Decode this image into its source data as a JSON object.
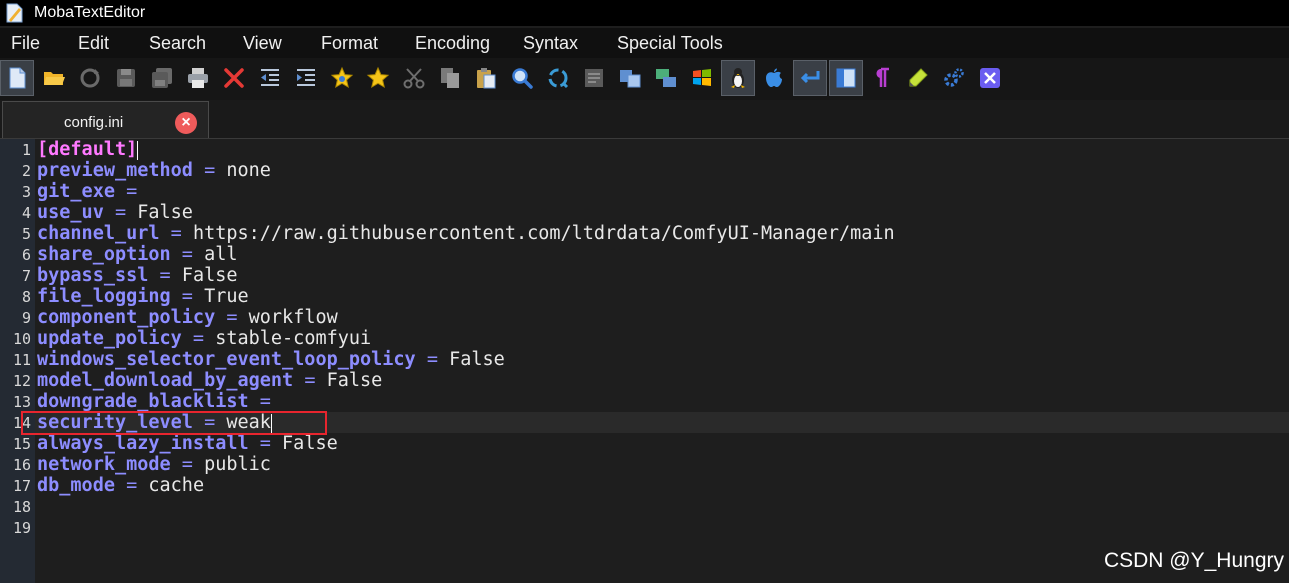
{
  "window": {
    "title": "MobaTextEditor"
  },
  "menu": [
    "File",
    "Edit",
    "Search",
    "View",
    "Format",
    "Encoding",
    "Syntax",
    "Special Tools"
  ],
  "toolbar_icons": [
    "new-file-icon",
    "open-folder-icon",
    "reload-icon",
    "save-icon",
    "save-all-icon",
    "print-icon",
    "close-file-icon",
    "unindent-icon",
    "indent-icon",
    "toggle-bookmark-icon",
    "next-bookmark-icon",
    "cut-icon",
    "copy-icon",
    "paste-icon",
    "find-icon",
    "find-replace-icon",
    "go-to-line-icon",
    "compare-icon",
    "convert-icon",
    "windows-eol-icon",
    "linux-eol-icon",
    "mac-eol-icon",
    "word-wrap-icon",
    "side-panel-icon",
    "show-symbols-icon",
    "highlight-icon",
    "settings-icon",
    "exit-icon"
  ],
  "tab": {
    "label": "config.ini",
    "close_symbol": "×"
  },
  "editor": {
    "line_numbers": [
      "1",
      "2",
      "3",
      "4",
      "5",
      "6",
      "7",
      "8",
      "9",
      "10",
      "11",
      "12",
      "13",
      "14",
      "15",
      "16",
      "17",
      "18",
      "19"
    ],
    "lines": [
      {
        "section": "[default]"
      },
      {
        "key": "preview_method",
        "eq": " = ",
        "value": "none"
      },
      {
        "key": "git_exe",
        "eq": " =",
        "value": ""
      },
      {
        "key": "use_uv",
        "eq": " = ",
        "value": "False"
      },
      {
        "key": "channel_url",
        "eq": " = ",
        "value": "https://raw.githubusercontent.com/ltdrdata/ComfyUI-Manager/main"
      },
      {
        "key": "share_option",
        "eq": " = ",
        "value": "all"
      },
      {
        "key": "bypass_ssl",
        "eq": " = ",
        "value": "False"
      },
      {
        "key": "file_logging",
        "eq": " = ",
        "value": "True"
      },
      {
        "key": "component_policy",
        "eq": " = ",
        "value": "workflow"
      },
      {
        "key": "update_policy",
        "eq": " = ",
        "value": "stable-comfyui"
      },
      {
        "key": "windows_selector_event_loop_policy",
        "eq": " = ",
        "value": "False"
      },
      {
        "key": "model_download_by_agent",
        "eq": " = ",
        "value": "False"
      },
      {
        "key": "downgrade_blacklist",
        "eq": " =",
        "value": ""
      },
      {
        "key": "security_level",
        "eq": " = ",
        "value": "weak"
      },
      {
        "key": "always_lazy_install",
        "eq": " = ",
        "value": "False"
      },
      {
        "key": "network_mode",
        "eq": " = ",
        "value": "public"
      },
      {
        "key": "db_mode",
        "eq": " = ",
        "value": "cache"
      }
    ]
  },
  "watermark": "CSDN @Y_Hungry",
  "colors": {
    "key": "#8d8dff",
    "section": "#ff79ff",
    "highlight_box": "#e8252e",
    "tab_close": "#ef5b5b"
  }
}
